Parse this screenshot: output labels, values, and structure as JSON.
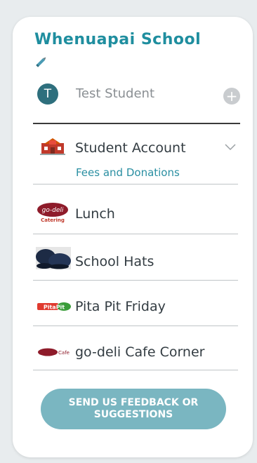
{
  "school": {
    "name": "Whenuapai School"
  },
  "student": {
    "initial": "T",
    "name": "Test Student"
  },
  "menu": {
    "student_account": {
      "label": "Student Account",
      "sublink": "Fees and Donations"
    },
    "items": [
      {
        "label": "Lunch",
        "icon": "go-deli-catering-logo",
        "logo_text": "go-deli",
        "logo_sub": "Catering"
      },
      {
        "label": "School Hats",
        "icon": "school-hats-photo"
      },
      {
        "label": "Pita Pit Friday",
        "icon": "pita-pit-logo",
        "logo_text": "PitaPit"
      },
      {
        "label": "go-deli Cafe Corner",
        "icon": "go-deli-cafe-logo",
        "logo_text": "Cafe"
      }
    ]
  },
  "feedback": {
    "label": "SEND US FEEDBACK OR SUGGESTIONS"
  },
  "colors": {
    "accent": "#1f8e9f",
    "button": "#7ab6c1",
    "text": "#333c42"
  }
}
